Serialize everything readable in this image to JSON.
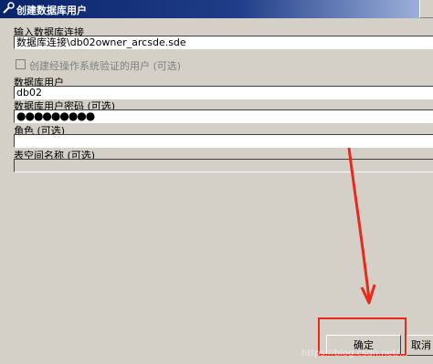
{
  "window": {
    "title": "创建数据库用户",
    "icon": "wrench-icon"
  },
  "form": {
    "connection": {
      "label": "输入数据库连接",
      "value": "数据库连接\\db02owner_arcsde.sde"
    },
    "os_auth_checkbox": {
      "label": "创建经操作系统验证的用户 (可选)",
      "checked": false,
      "enabled": false
    },
    "db_user": {
      "label": "数据库用户",
      "value": "db02"
    },
    "db_password": {
      "label": "数据库用户密码 (可选)",
      "value": "●●●●●●●●●"
    },
    "role": {
      "label": "角色 (可选)",
      "value": ""
    },
    "tablespace": {
      "label": "表空间名称 (可选)",
      "value": ""
    }
  },
  "buttons": {
    "ok": "确定",
    "cancel": "取消"
  },
  "annotation": {
    "color": "#e8291c"
  },
  "watermark": "https://blog.csdn.net/..."
}
